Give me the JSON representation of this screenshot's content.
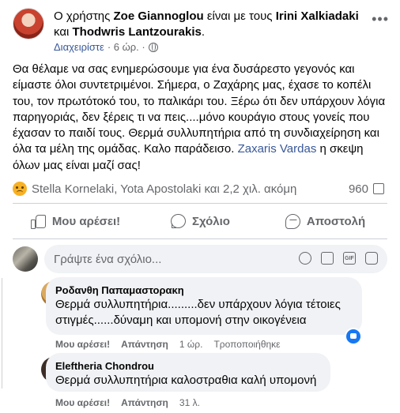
{
  "post": {
    "header_prefix": "Ο χρήστης",
    "author": "Zoe Giannoglou",
    "with_word": "είναι με τους",
    "tagged_1": "Irini Xalkiadaki",
    "and_word": "και",
    "tagged_2": "Thodwris Lantzourakis",
    "tagged_2_suffix": ".",
    "meta_link": "Διαχειρίστε",
    "meta_time": "· 6 ώρ. ·",
    "body_text": "Θα θέλαμε να σας ενημερώσουμε για ένα δυσάρεστο γεγονός και είμαστε όλοι συντετριμένοι. Σήμερα, ο Ζαχάρης μας, έχασε το κοπέλι του, τον πρωτότοκό του, το παλικάρι του. Ξέρω ότι δεν υπάρχουν λόγια παρηγοριάς, δεν ξέρεις τι να πεις....μόνο κουράγιο στους γονείς που έχασαν το παιδί τους. Θερμά συλλυπητήρια από τη συνδιαχείρηση και όλα τα μέλη της ομάδας. Καλο παράδεισο.",
    "body_mention": "Zaxaris Vardas",
    "body_end": "η σκεψη όλων μας είναι μαζί σας!"
  },
  "reactions": {
    "icon": "sad-reaction-icon",
    "text": "Stella Kornelaki, Yota Apostolaki και 2,2 χιλ. ακόμη",
    "shares": "960"
  },
  "actions": {
    "like": "Μου αρέσει!",
    "comment": "Σχόλιο",
    "share": "Αποστολή"
  },
  "composer": {
    "placeholder": "Γράψτε ένα σχόλιο..."
  },
  "comments": [
    {
      "name": "Ροδανθη Παπαμαστορακη",
      "text": "Θερμά συλλυπητήρια.........δεν υπάρχουν λόγια τέτοιες στιγμές......δύναμη και υπομονή στην οικογένεια",
      "like": "Μου αρέσει!",
      "reply": "Απάντηση",
      "time": "1 ώρ.",
      "edited": "Τροποποιήθηκε"
    },
    {
      "name": "Eleftheria Chondrou",
      "text": "Θερμά συλλυπητήρια καλοστραθια καλή υπομονή",
      "like": "Μου αρέσει!",
      "reply": "Απάντηση",
      "time": "31 λ."
    }
  ],
  "colors": {
    "link": "#385898",
    "secondary_text": "#65676b",
    "bubble": "#f0f2f5",
    "like_blue": "#1877f2"
  }
}
